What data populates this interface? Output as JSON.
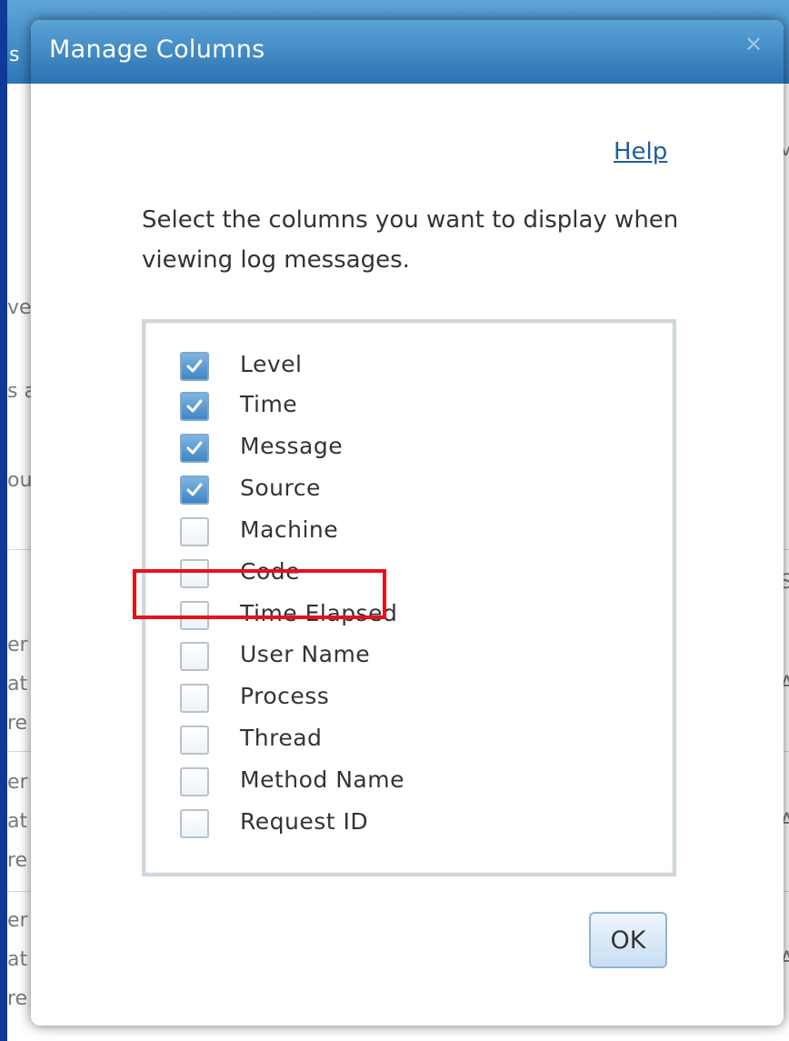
{
  "dialog": {
    "title": "Manage Columns",
    "close_glyph": "✕",
    "help_link": "Help",
    "instructions": "Select the columns you want to display when viewing log messages.",
    "ok_label": "OK"
  },
  "columns": [
    {
      "label": "Level",
      "checked": true
    },
    {
      "label": "Time",
      "checked": true
    },
    {
      "label": "Message",
      "checked": true
    },
    {
      "label": "Source",
      "checked": true
    },
    {
      "label": "Machine",
      "checked": false
    },
    {
      "label": "Code",
      "checked": false
    },
    {
      "label": "Time Elapsed",
      "checked": false
    },
    {
      "label": "User Name",
      "checked": false
    },
    {
      "label": "Process",
      "checked": false
    },
    {
      "label": "Thread",
      "checked": false
    },
    {
      "label": "Method Name",
      "checked": false
    },
    {
      "label": "Request ID",
      "checked": false
    }
  ],
  "highlighted_item": "Time Elapsed",
  "background_fragments": [
    "s",
    "ve",
    "s a",
    "ou",
    "er",
    "at",
    "re",
    "er",
    "at",
    "re",
    "er",
    "at",
    "re",
    "v",
    "S",
    "A",
    "A",
    "A"
  ],
  "colors": {
    "titlebar": "#3a86c4",
    "highlight": "#e5121b",
    "checkbox_checked": "#4a8fcd",
    "outer_background": "#0f3a99"
  },
  "icons": {
    "close": "close-icon",
    "check": "checkmark-icon"
  }
}
